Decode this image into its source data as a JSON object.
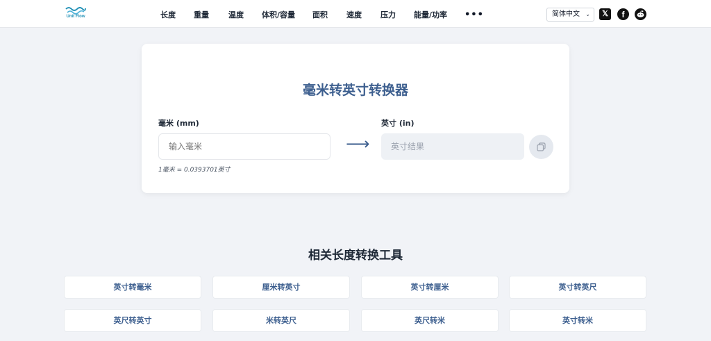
{
  "header": {
    "logo_text": "Unit Flow",
    "nav": [
      "长度",
      "重量",
      "温度",
      "体积/容量",
      "面积",
      "速度",
      "压力",
      "能量/功率"
    ],
    "more": "•••",
    "language": "简体中文",
    "social": {
      "x": "𝕏",
      "facebook": "f",
      "reddit": "●"
    }
  },
  "converter": {
    "title": "毫米转英寸转换器",
    "from_label": "毫米 (mm)",
    "from_placeholder": "输入毫米",
    "to_label": "英寸 (in)",
    "to_placeholder": "英寸结果",
    "arrow": "⟶",
    "hint": "1毫米 = 0.0393701英寸"
  },
  "related": {
    "title": "相关长度转换工具",
    "tools": [
      "英寸转毫米",
      "厘米转英寸",
      "英寸转厘米",
      "英寸转英尺",
      "英尺转英寸",
      "米转英尺",
      "英尺转米",
      "英寸转米"
    ]
  }
}
